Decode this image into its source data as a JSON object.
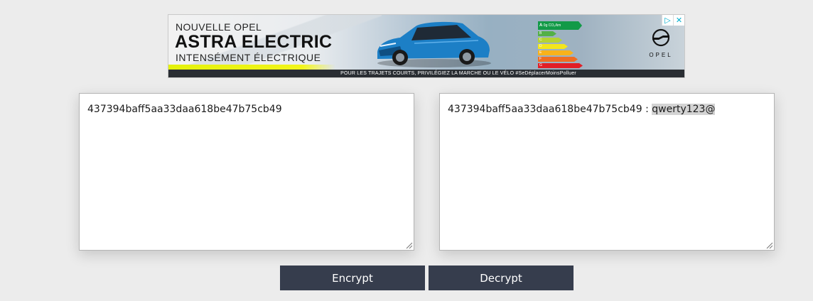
{
  "ad": {
    "line1": "NOUVELLE OPEL",
    "line2": "ASTRA ELECTRIC",
    "line3": "INTENSÉMENT ÉLECTRIQUE",
    "energy_label_a": "A",
    "energy_label_a_note": "0g CO₂/km",
    "energy_classes": [
      "B",
      "C",
      "D",
      "E",
      "F",
      "G"
    ],
    "brand": "OPEL",
    "footer": "POUR LES TRAJETS COURTS, PRIVILÉGIEZ LA MARCHE OU LE VÉLO #SeDéplacerMoinsPolluer",
    "adchoices_icon": "play-triangle-icon",
    "close_icon": "close-x-icon"
  },
  "input": {
    "value": "437394baff5aa33daa618be47b75cb49"
  },
  "output": {
    "hash": "437394baff5aa33daa618be47b75cb49",
    "separator": " : ",
    "plaintext": "qwerty123@"
  },
  "buttons": {
    "encrypt_label": "Encrypt",
    "decrypt_label": "Decrypt"
  },
  "colors": {
    "background": "#ececec",
    "button_bg": "#363d4d",
    "button_text": "#ffffff",
    "highlight": "#d3d3d3"
  }
}
